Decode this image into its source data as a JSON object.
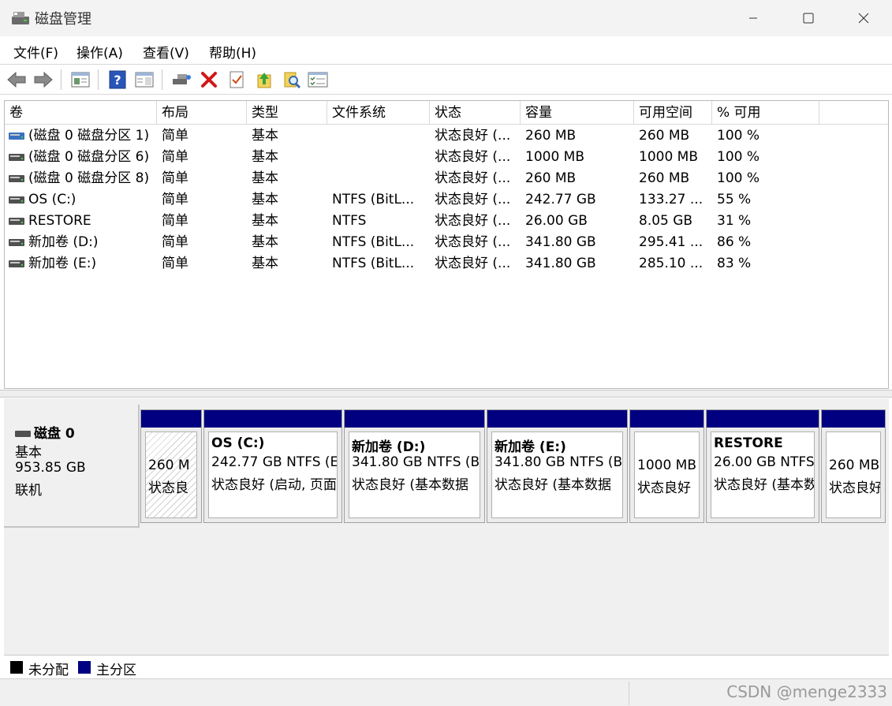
{
  "window": {
    "title": "磁盘管理",
    "minimize": "—",
    "maximize": "☐",
    "close": "✕"
  },
  "menu": [
    "文件(F)",
    "操作(A)",
    "查看(V)",
    "帮助(H)"
  ],
  "toolbar": [
    {
      "name": "back-arrow-icon"
    },
    {
      "name": "forward-arrow-icon"
    },
    {
      "name": "properties-icon"
    },
    {
      "name": "help-icon"
    },
    {
      "name": "show-pane-icon"
    },
    {
      "name": "connect-disk-icon"
    },
    {
      "name": "delete-icon"
    },
    {
      "name": "check-icon"
    },
    {
      "name": "up-arrow-icon"
    },
    {
      "name": "search-icon"
    },
    {
      "name": "list-view-icon"
    }
  ],
  "columns": [
    "卷",
    "布局",
    "类型",
    "文件系统",
    "状态",
    "容量",
    "可用空间",
    "% 可用"
  ],
  "volumes": [
    {
      "icon": "blue",
      "name": "(磁盘 0 磁盘分区 1)",
      "layout": "简单",
      "type": "基本",
      "fs": "",
      "status": "状态良好 (...",
      "capacity": "260 MB",
      "free": "260 MB",
      "pct": "100 %"
    },
    {
      "icon": "gray",
      "name": "(磁盘 0 磁盘分区 6)",
      "layout": "简单",
      "type": "基本",
      "fs": "",
      "status": "状态良好 (...",
      "capacity": "1000 MB",
      "free": "1000 MB",
      "pct": "100 %"
    },
    {
      "icon": "gray",
      "name": "(磁盘 0 磁盘分区 8)",
      "layout": "简单",
      "type": "基本",
      "fs": "",
      "status": "状态良好 (...",
      "capacity": "260 MB",
      "free": "260 MB",
      "pct": "100 %"
    },
    {
      "icon": "gray",
      "name": "OS (C:)",
      "layout": "简单",
      "type": "基本",
      "fs": "NTFS (BitL...",
      "status": "状态良好 (...",
      "capacity": "242.77 GB",
      "free": "133.27 ...",
      "pct": "55 %"
    },
    {
      "icon": "gray",
      "name": "RESTORE",
      "layout": "简单",
      "type": "基本",
      "fs": "NTFS",
      "status": "状态良好 (...",
      "capacity": "26.00 GB",
      "free": "8.05 GB",
      "pct": "31 %"
    },
    {
      "icon": "gray",
      "name": "新加卷 (D:)",
      "layout": "简单",
      "type": "基本",
      "fs": "NTFS (BitL...",
      "status": "状态良好 (...",
      "capacity": "341.80 GB",
      "free": "295.41 ...",
      "pct": "86 %"
    },
    {
      "icon": "gray",
      "name": "新加卷 (E:)",
      "layout": "简单",
      "type": "基本",
      "fs": "NTFS (BitL...",
      "status": "状态良好 (...",
      "capacity": "341.80 GB",
      "free": "285.10 ...",
      "pct": "83 %"
    }
  ],
  "disk": {
    "name": "磁盘 0",
    "type": "基本",
    "size": "953.85 GB",
    "state": "联机"
  },
  "partitions": [
    {
      "name": "",
      "line1": "260 M",
      "line2": "状态良",
      "hatched": true
    },
    {
      "name": "OS  (C:)",
      "line1": "242.77 GB NTFS (E",
      "line2": "状态良好 (启动, 页面",
      "hatched": false
    },
    {
      "name": "新加卷  (D:)",
      "line1": "341.80 GB NTFS (B",
      "line2": "状态良好 (基本数据",
      "hatched": false
    },
    {
      "name": "新加卷  (E:)",
      "line1": "341.80 GB NTFS (B",
      "line2": "状态良好 (基本数据",
      "hatched": false
    },
    {
      "name": "",
      "line1": "1000 MB",
      "line2": "状态良好",
      "hatched": false
    },
    {
      "name": "RESTORE",
      "line1": "26.00 GB NTFS",
      "line2": "状态良好 (基本数",
      "hatched": false
    },
    {
      "name": "",
      "line1": "260 MB",
      "line2": "状态良好",
      "hatched": false
    }
  ],
  "legend": [
    {
      "label": "未分配",
      "color": "#000000"
    },
    {
      "label": "主分区",
      "color": "#000080"
    }
  ],
  "watermark": "CSDN @menge2333"
}
